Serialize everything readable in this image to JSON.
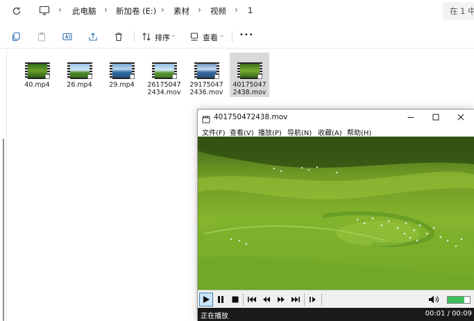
{
  "address": {
    "crumbs": [
      "此电脑",
      "新加卷 (E:)",
      "素材",
      "视频",
      "1"
    ],
    "search_text": "在 1 中"
  },
  "toolbar": {
    "sort_label": "排序",
    "view_label": "查看",
    "more_label": "•••"
  },
  "files": [
    {
      "name": "40.mp4",
      "selected": false
    },
    {
      "name": "26.mp4",
      "selected": false
    },
    {
      "name": "29.mp4",
      "selected": false
    },
    {
      "name": "26175047\n2434.mov",
      "selected": false
    },
    {
      "name": "29175047\n2436.mov",
      "selected": false
    },
    {
      "name": "40175047\n2438.mov",
      "selected": true
    }
  ],
  "player": {
    "title": "401750472438.mov",
    "menu": [
      "文件(F)",
      "查看(V)",
      "播放(P)",
      "导航(N)",
      "收藏(A)",
      "帮助(H)"
    ],
    "status": "正在播放",
    "time": "00:01 / 00:09",
    "volume_fraction": 0.75
  },
  "colors": {
    "accent": "#3c7fb1",
    "volume": "#3fbf5a",
    "status_bg": "#1a1a1a"
  }
}
